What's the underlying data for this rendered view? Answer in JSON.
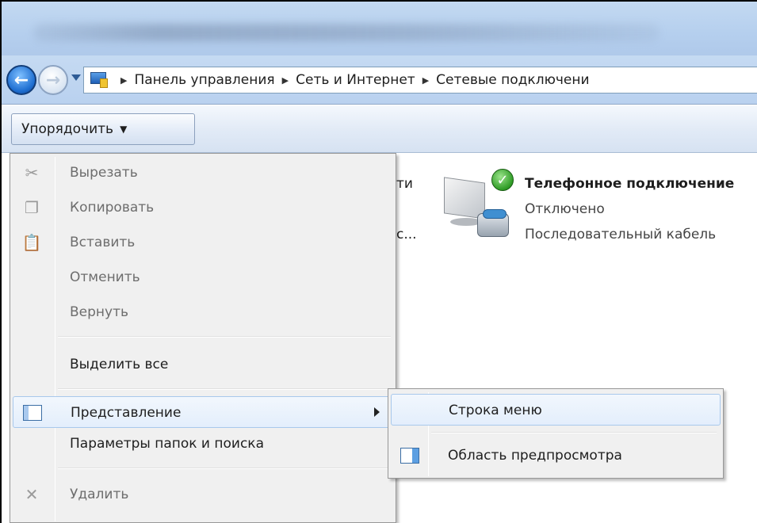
{
  "window": {
    "title_blurred": true
  },
  "address": {
    "crumbs": [
      "Панель управления",
      "Сеть и Интернет",
      "Сетевые подключени"
    ]
  },
  "toolbar": {
    "organize_label": "Упорядочить"
  },
  "content": {
    "partial_text_1": "ти",
    "partial_text_2": "с...",
    "connection": {
      "name": "Телефонное подключение",
      "status": "Отключено",
      "device": "Последовательный кабель"
    }
  },
  "menu": {
    "items": [
      {
        "label": "Вырезать",
        "icon": "scissors-icon",
        "enabled": false
      },
      {
        "label": "Копировать",
        "icon": "copy-icon",
        "enabled": false
      },
      {
        "label": "Вставить",
        "icon": "paste-icon",
        "enabled": false
      },
      {
        "label": "Отменить",
        "enabled": false
      },
      {
        "label": "Вернуть",
        "enabled": false
      },
      {
        "label": "Выделить все",
        "enabled": true
      },
      {
        "label": "Представление",
        "icon": "layout-icon",
        "enabled": true,
        "has_submenu": true,
        "highlighted": true
      },
      {
        "label": "Параметры папок и поиска",
        "enabled": true
      },
      {
        "label": "Удалить",
        "icon": "delete-icon",
        "enabled": false
      }
    ]
  },
  "submenu": {
    "items": [
      {
        "label": "Строка меню",
        "highlighted": true
      },
      {
        "label": "Область предпросмотра",
        "icon": "preview-pane-icon"
      }
    ]
  },
  "colors": {
    "titlebar": "#b5cfee",
    "menu_bg": "#f0f0f0",
    "highlight_border": "#a8c8ec"
  }
}
